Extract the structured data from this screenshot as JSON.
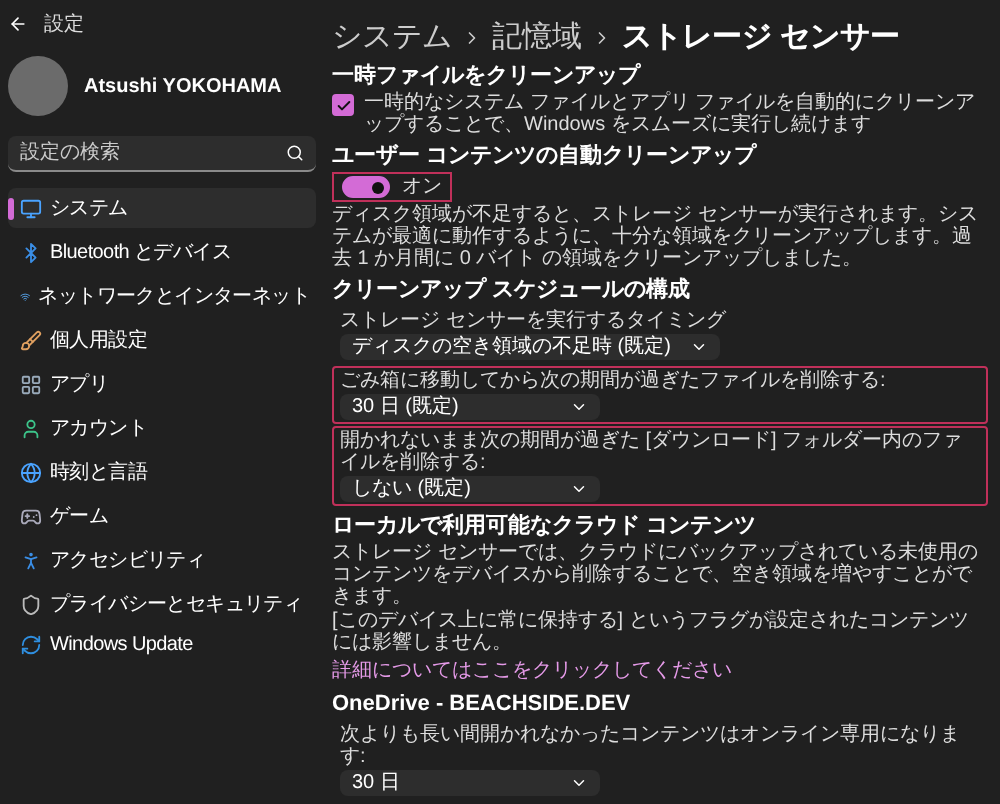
{
  "window": {
    "title": "設定"
  },
  "account": {
    "name": "Atsushi YOKOHAMA"
  },
  "search": {
    "placeholder": "設定の検索"
  },
  "sidebar": {
    "items": [
      {
        "label": "システム",
        "selected": true
      },
      {
        "label": "Bluetooth とデバイス",
        "selected": false
      },
      {
        "label": "ネットワークとインターネット",
        "selected": false
      },
      {
        "label": "個人用設定",
        "selected": false
      },
      {
        "label": "アプリ",
        "selected": false
      },
      {
        "label": "アカウント",
        "selected": false
      },
      {
        "label": "時刻と言語",
        "selected": false
      },
      {
        "label": "ゲーム",
        "selected": false
      },
      {
        "label": "アクセシビリティ",
        "selected": false
      },
      {
        "label": "プライバシーとセキュリティ",
        "selected": false
      },
      {
        "label": "Windows Update",
        "selected": false
      }
    ]
  },
  "breadcrumb": [
    "システム",
    "記憶域",
    "ストレージ センサー"
  ],
  "sections": [
    {
      "heading": "一時ファイルをクリーンアップ",
      "checkbox": {
        "label": "一時的なシステム ファイルとアプリ ファイルを自動的にクリーンアップすることで、Windows をスムーズに実行し続けます",
        "checked": true
      }
    },
    {
      "heading": "ユーザー コンテンツの自動クリーンアップ",
      "toggle": {
        "label": "オン",
        "on": true,
        "highlighted": true
      },
      "paragraphs": [
        "ディスク領域が不足すると、ストレージ センサーが実行されます。システムが最適に動作するように、十分な領域をクリーンアップします。過去 1 か月間に 0 バイト の領域をクリーンアップしました。"
      ]
    },
    {
      "heading": "クリーンアップ スケジュールの構成",
      "settings": [
        {
          "label": "ストレージ センサーを実行するタイミング",
          "value": "ディスクの空き領域の不足時 (既定)",
          "highlighted": false
        },
        {
          "label": "ごみ箱に移動してから次の期間が過ぎたファイルを削除する:",
          "value": "30 日 (既定)",
          "highlighted": true
        },
        {
          "label": "開かれないまま次の期間が過ぎた [ダウンロード] フォルダー内のファイルを削除する:",
          "value": "しない (既定)",
          "highlighted": true
        }
      ]
    },
    {
      "heading": "ローカルで利用可能なクラウド コンテンツ",
      "paragraphs": [
        "ストレージ センサーでは、クラウドにバックアップされている未使用のコンテンツをデバイスから削除することで、空き領域を増やすことができます。",
        "[このデバイス上に常に保持する] というフラグが設定されたコンテンツには影響しません。"
      ],
      "link": "詳細についてはここをクリックしてください"
    },
    {
      "heading": "OneDrive - BEACHSIDE.DEV",
      "settings": [
        {
          "label": "次よりも長い間開かれなかったコンテンツはオンライン専用になります:",
          "value": "30 日",
          "highlighted": false
        }
      ]
    }
  ]
}
